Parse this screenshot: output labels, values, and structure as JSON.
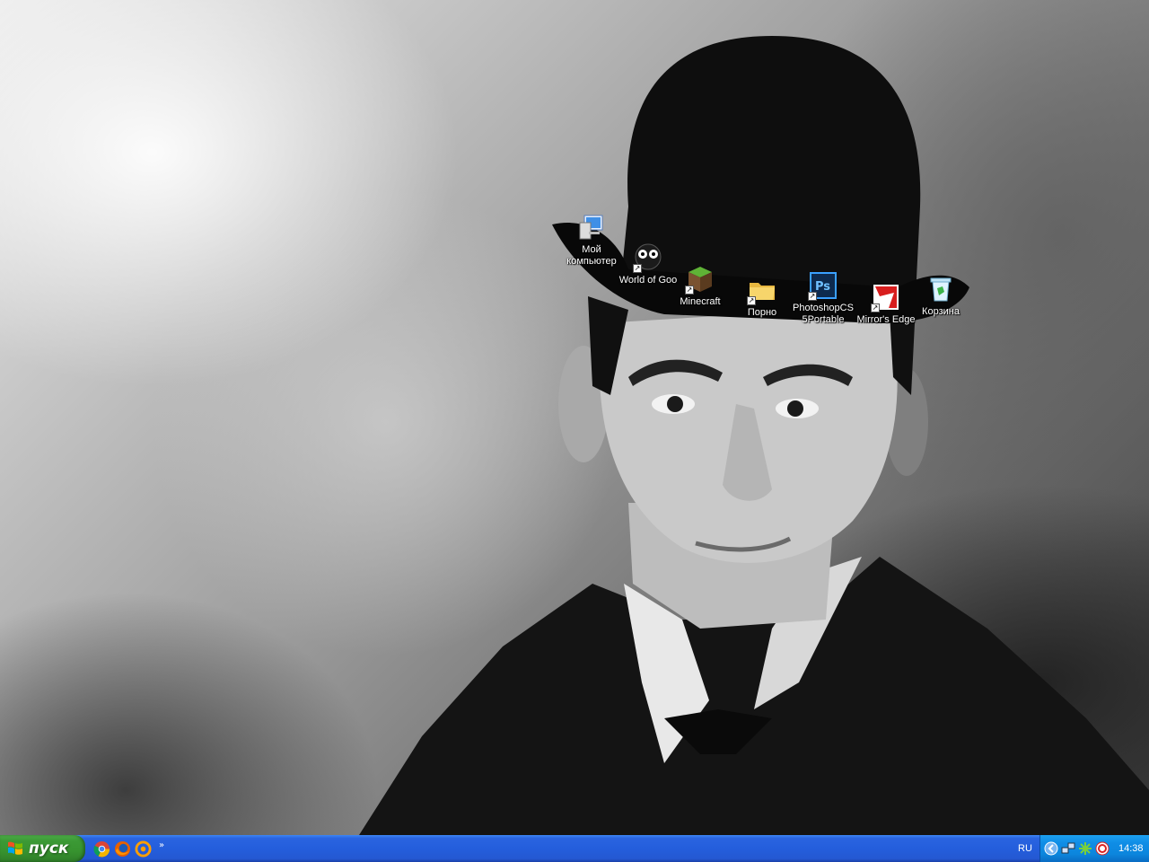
{
  "desktop": {
    "icons": [
      {
        "label": "Мой\nкомпьютер",
        "icon": "my-computer-icon",
        "shortcut": false
      },
      {
        "label": "World of Goo",
        "icon": "world-of-goo-icon",
        "shortcut": true
      },
      {
        "label": "Minecraft",
        "icon": "minecraft-icon",
        "shortcut": true
      },
      {
        "label": "Порно",
        "icon": "folder-icon",
        "shortcut": true
      },
      {
        "label": "PhotoshopCS\n5Portable",
        "icon": "photoshop-icon",
        "shortcut": true
      },
      {
        "label": "Mirror's Edge",
        "icon": "mirrors-edge-icon",
        "shortcut": true
      },
      {
        "label": "Корзина",
        "icon": "recycle-bin-icon",
        "shortcut": false
      }
    ]
  },
  "taskbar": {
    "start_label": "пуск",
    "quick_launch": [
      "chrome-icon",
      "firefox-icon",
      "mail-ru-agent-icon"
    ],
    "quick_launch_more": "»",
    "language": "RU",
    "tray": [
      "network-icon",
      "utorrent-icon",
      "antivirus-icon"
    ],
    "clock": "14:38"
  }
}
